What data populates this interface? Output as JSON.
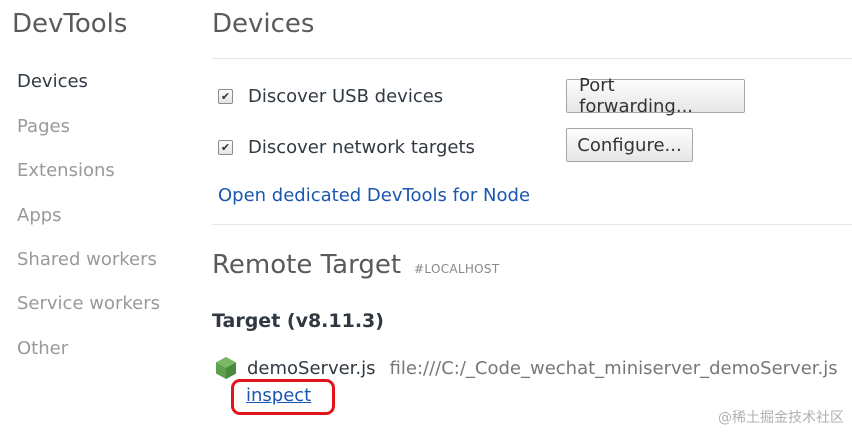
{
  "sidebar": {
    "title": "DevTools",
    "items": [
      {
        "label": "Devices",
        "active": true
      },
      {
        "label": "Pages",
        "active": false
      },
      {
        "label": "Extensions",
        "active": false
      },
      {
        "label": "Apps",
        "active": false
      },
      {
        "label": "Shared workers",
        "active": false
      },
      {
        "label": "Service workers",
        "active": false
      },
      {
        "label": "Other",
        "active": false
      }
    ]
  },
  "main": {
    "title": "Devices",
    "usb": {
      "label": "Discover USB devices",
      "checked": true,
      "button": "Port forwarding..."
    },
    "network": {
      "label": "Discover network targets",
      "checked": true,
      "button": "Configure..."
    },
    "node_link": "Open dedicated DevTools for Node"
  },
  "remote": {
    "title": "Remote Target",
    "badge": "#LOCALHOST",
    "target_title": "Target (v8.11.3)",
    "target": {
      "icon": "node-hexagon-icon",
      "name": "demoServer.js",
      "path": "file:///C:/_Code_wechat_miniserver_demoServer.js",
      "inspect": "inspect"
    }
  },
  "watermark": "@稀土掘金技术社区",
  "colors": {
    "link": "#1a56b0",
    "highlight": "#e0141a",
    "node_green": "#5fa04e"
  }
}
